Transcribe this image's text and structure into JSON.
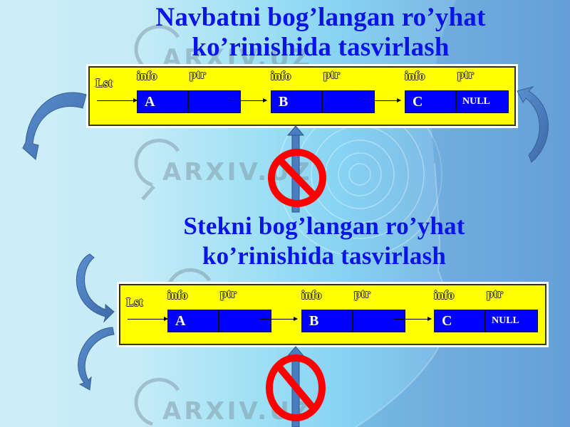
{
  "slide": {
    "queue_title": [
      "Navbatni bog’langan ro’yhat",
      "ko’rinishida tasvirlash"
    ],
    "stack_title": [
      "Stekni bog’langan ro’yhat",
      "ko’rinishida tasvirlash"
    ]
  },
  "queue_diagram": {
    "head_label": "Lst",
    "nodes": [
      {
        "info_label": "info",
        "ptr_label": "ptr",
        "info": "A",
        "ptr": ""
      },
      {
        "info_label": "info",
        "ptr_label": "ptr",
        "info": "B",
        "ptr": ""
      },
      {
        "info_label": "info",
        "ptr_label": "ptr",
        "info": "C",
        "ptr": "NULL"
      }
    ]
  },
  "stack_diagram": {
    "head_label": "Lst",
    "nodes": [
      {
        "info_label": "info",
        "ptr_label": "ptr",
        "info": "A",
        "ptr": ""
      },
      {
        "info_label": "info",
        "ptr_label": "ptr",
        "info": "B",
        "ptr": ""
      },
      {
        "info_label": "info",
        "ptr_label": "ptr",
        "info": "C",
        "ptr": "NULL"
      }
    ]
  },
  "icons": {
    "curved_arrow": "curved-arrow-icon",
    "prohibition": "prohibition-sign-icon",
    "up_arrow": "up-arrow-icon"
  },
  "watermark": {
    "text": "ARXIV.UZ"
  },
  "colors": {
    "title": "#0a14e6",
    "diagram_bg": "#ffff00",
    "node_fill": "#0000ff",
    "arrow": "#4a7cc0",
    "prohibition": "#ff0000"
  }
}
